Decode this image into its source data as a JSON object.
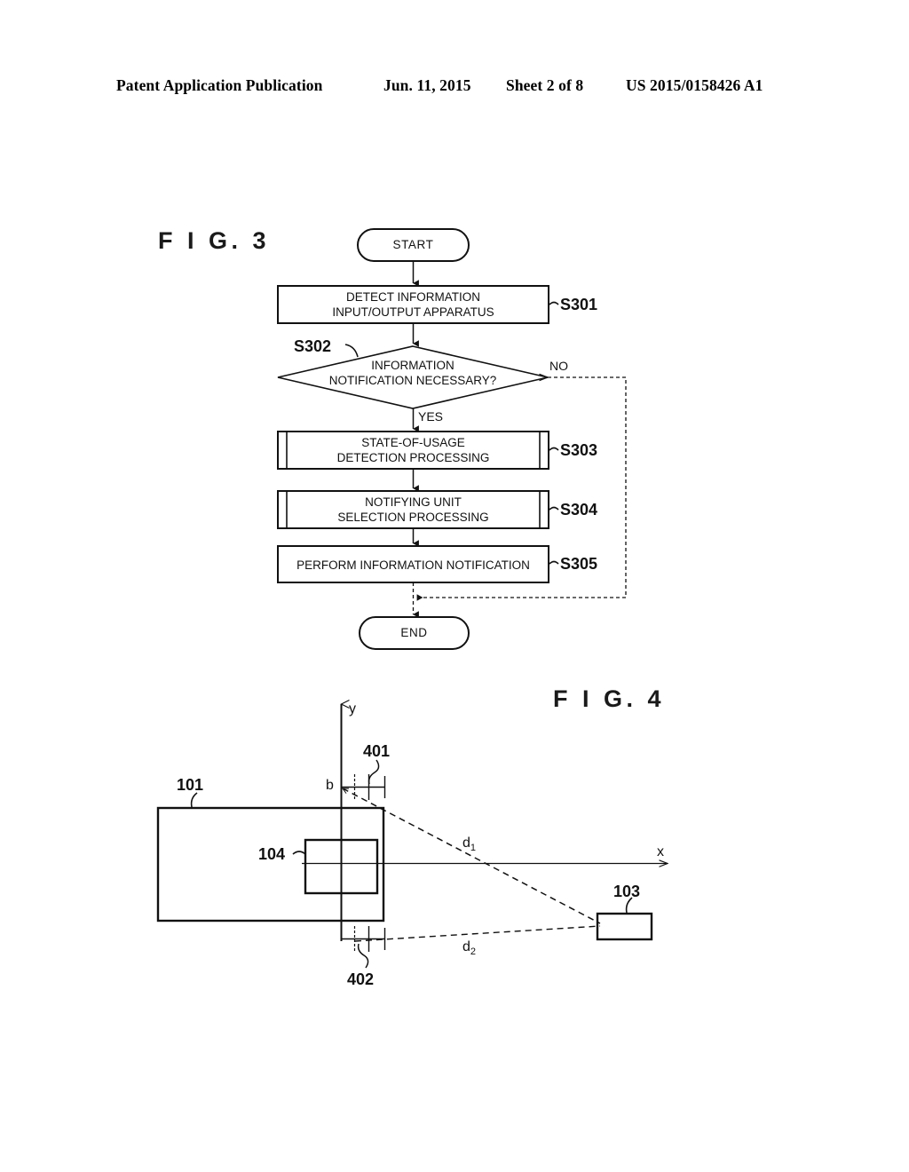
{
  "header": {
    "publication": "Patent Application Publication",
    "date": "Jun. 11, 2015",
    "sheet": "Sheet 2 of 8",
    "patent_number": "US 2015/0158426 A1"
  },
  "figures": [
    {
      "title": "F I G.  3",
      "type": "flowchart"
    },
    {
      "title": "F I G.  4",
      "type": "geometry-diagram"
    }
  ],
  "flowchart": {
    "title": "F I G.  3",
    "nodes": [
      {
        "id": "start",
        "shape": "terminator",
        "text": "START"
      },
      {
        "id": "s301",
        "shape": "process",
        "text": "DETECT INFORMATION\nINPUT/OUTPUT APPARATUS",
        "step": "S301"
      },
      {
        "id": "s302",
        "shape": "decision",
        "text": "INFORMATION\nNOTIFICATION NECESSARY?",
        "step": "S302",
        "branch_yes": "YES",
        "branch_no": "NO"
      },
      {
        "id": "s303",
        "shape": "predefined-process",
        "text": "STATE-OF-USAGE\nDETECTION PROCESSING",
        "step": "S303"
      },
      {
        "id": "s304",
        "shape": "predefined-process",
        "text": "NOTIFYING UNIT\nSELECTION PROCESSING",
        "step": "S304"
      },
      {
        "id": "s305",
        "shape": "process",
        "text": "PERFORM INFORMATION NOTIFICATION",
        "step": "S305"
      },
      {
        "id": "end",
        "shape": "terminator",
        "text": "END"
      }
    ]
  },
  "diagram": {
    "title": "F I G.  4",
    "axes": {
      "x_label": "x",
      "y_label": "y",
      "origin_label": "b"
    },
    "reference_numerals": [
      {
        "id": "101",
        "label": "101",
        "describes": "large-rectangle"
      },
      {
        "id": "104",
        "label": "104",
        "describes": "inner-rectangle"
      },
      {
        "id": "103",
        "label": "103",
        "describes": "small-right-rectangle"
      },
      {
        "id": "401",
        "label": "401",
        "describes": "upper-dimension-marker"
      },
      {
        "id": "402",
        "label": "402",
        "describes": "lower-dimension-marker"
      }
    ],
    "distances": [
      {
        "id": "d1",
        "label": "d",
        "subscript": "1"
      },
      {
        "id": "d2",
        "label": "d",
        "subscript": "2"
      }
    ]
  }
}
